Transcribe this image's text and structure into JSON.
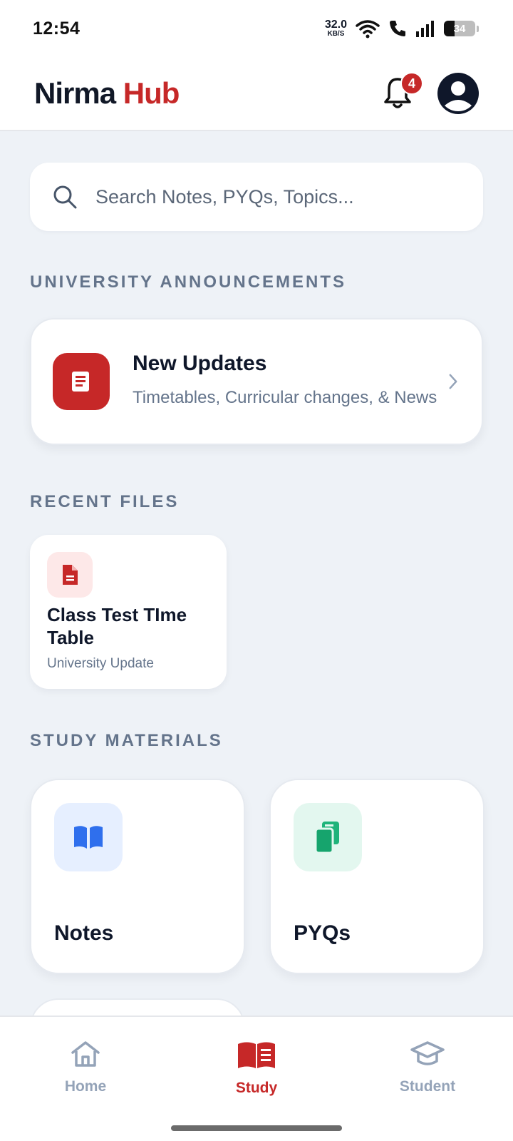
{
  "status_bar": {
    "time": "12:54",
    "net_speed": "32.0",
    "net_unit": "KB/S",
    "battery": "34"
  },
  "header": {
    "brand_part1": "Nirma",
    "brand_part2": "Hub",
    "notification_count": "4"
  },
  "search": {
    "placeholder": "Search Notes, PYQs, Topics..."
  },
  "announcements": {
    "section_title": "UNIVERSITY ANNOUNCEMENTS",
    "card_title": "New Updates",
    "card_subtitle": "Timetables, Curricular changes, & News"
  },
  "recent_files": {
    "section_title": "RECENT FILES",
    "items": [
      {
        "title": "Class Test TIme Table",
        "subtitle": "University Update"
      }
    ]
  },
  "study_materials": {
    "section_title": "STUDY MATERIALS",
    "tiles": [
      {
        "label": "Notes",
        "icon": "book-icon"
      },
      {
        "label": "PYQs",
        "icon": "copy-files-icon"
      }
    ]
  },
  "bottom_nav": {
    "items": [
      {
        "label": "Home",
        "icon": "home-icon",
        "active": false
      },
      {
        "label": "Study",
        "icon": "book-open-icon",
        "active": true
      },
      {
        "label": "Student",
        "icon": "graduation-cap-icon",
        "active": false
      }
    ]
  },
  "colors": {
    "brand_red": "#c62828",
    "text_dark": "#0f172a",
    "muted": "#64748b",
    "background": "#eef2f7"
  }
}
